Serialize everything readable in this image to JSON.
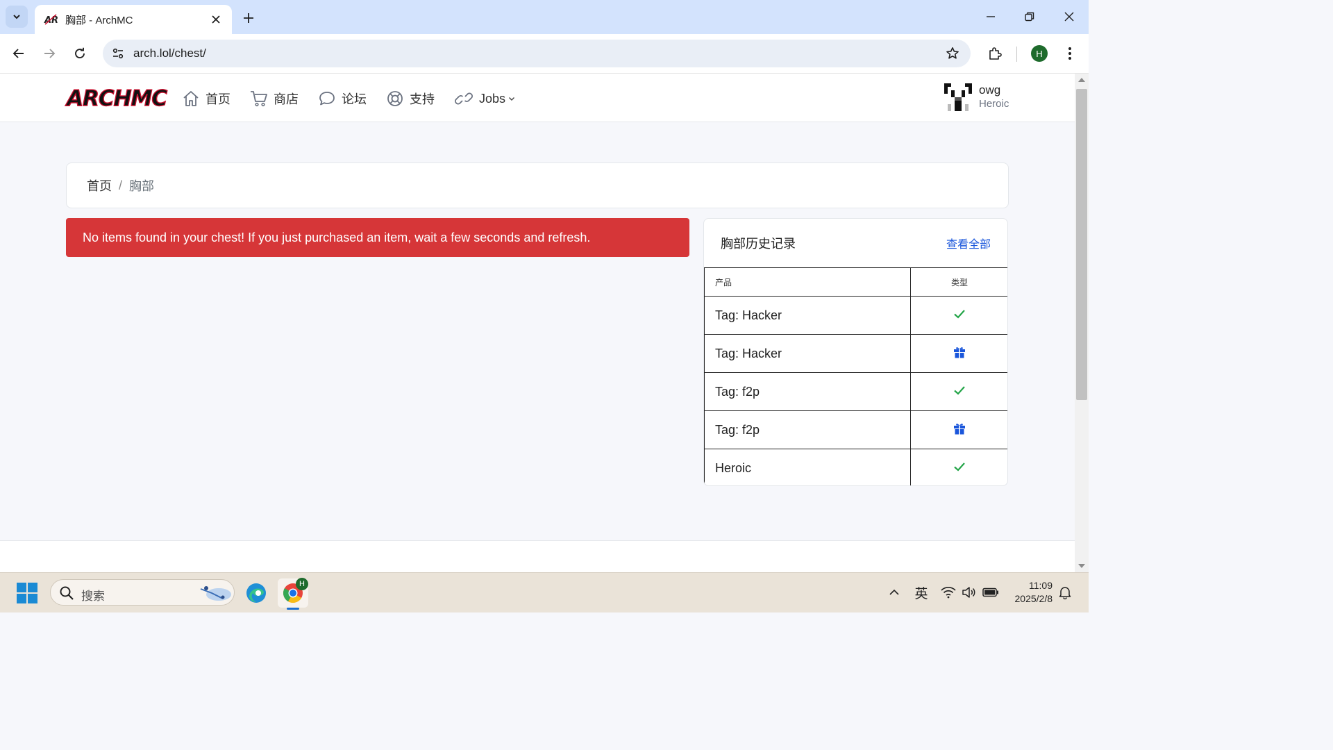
{
  "browser": {
    "tab_title": "胸部 - ArchMC",
    "url": "arch.lol/chest/",
    "profile_initial": "H"
  },
  "site": {
    "logo_text": "ARCHMC",
    "nav": [
      {
        "label": "首页",
        "icon": "home-icon"
      },
      {
        "label": "商店",
        "icon": "cart-icon"
      },
      {
        "label": "论坛",
        "icon": "chat-icon"
      },
      {
        "label": "支持",
        "icon": "lifebuoy-icon"
      },
      {
        "label": "Jobs",
        "icon": "link-icon",
        "dropdown": true
      }
    ],
    "user": {
      "name": "owg",
      "rank": "Heroic"
    }
  },
  "breadcrumb": {
    "home": "首页",
    "separator": "/",
    "current": "胸部"
  },
  "alert": {
    "text": "No items found in your chest! If you just purchased an item, wait a few seconds and refresh.",
    "color": "#d63638"
  },
  "history": {
    "title": "胸部历史记录",
    "view_all": "查看全部",
    "columns": [
      "产品",
      "类型"
    ],
    "rows": [
      {
        "product": "Tag: Hacker",
        "type": "check-icon"
      },
      {
        "product": "Tag: Hacker",
        "type": "gift-icon"
      },
      {
        "product": "Tag: f2p",
        "type": "check-icon"
      },
      {
        "product": "Tag: f2p",
        "type": "gift-icon"
      },
      {
        "product": "Heroic",
        "type": "check-icon"
      }
    ],
    "check_color": "#22a447",
    "gift_color": "#1a56db"
  },
  "taskbar": {
    "search_placeholder": "搜索",
    "ime": "英",
    "time": "11:09",
    "date": "2025/2/8",
    "chrome_badge": "H"
  }
}
